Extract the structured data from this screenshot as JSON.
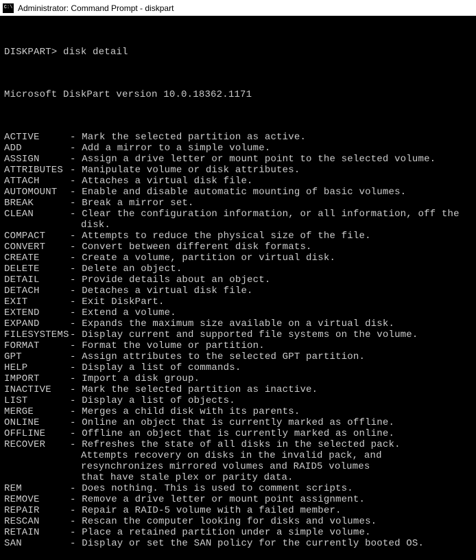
{
  "titlebar": {
    "icon_text": "C:\\",
    "title": "Administrator: Command Prompt - diskpart"
  },
  "prompt": "DISKPART>",
  "command_input": "disk detail",
  "version_line": "Microsoft DiskPart version 10.0.18362.1171",
  "commands": [
    {
      "name": "ACTIVE",
      "desc": [
        "Mark the selected partition as active."
      ]
    },
    {
      "name": "ADD",
      "desc": [
        "Add a mirror to a simple volume."
      ]
    },
    {
      "name": "ASSIGN",
      "desc": [
        "Assign a drive letter or mount point to the selected volume."
      ]
    },
    {
      "name": "ATTRIBUTES",
      "desc": [
        "Manipulate volume or disk attributes."
      ]
    },
    {
      "name": "ATTACH",
      "desc": [
        "Attaches a virtual disk file."
      ]
    },
    {
      "name": "AUTOMOUNT",
      "desc": [
        "Enable and disable automatic mounting of basic volumes."
      ]
    },
    {
      "name": "BREAK",
      "desc": [
        "Break a mirror set."
      ]
    },
    {
      "name": "CLEAN",
      "desc": [
        "Clear the configuration information, or all information, off the",
        "disk."
      ]
    },
    {
      "name": "COMPACT",
      "desc": [
        "Attempts to reduce the physical size of the file."
      ]
    },
    {
      "name": "CONVERT",
      "desc": [
        "Convert between different disk formats."
      ]
    },
    {
      "name": "CREATE",
      "desc": [
        "Create a volume, partition or virtual disk."
      ]
    },
    {
      "name": "DELETE",
      "desc": [
        "Delete an object."
      ]
    },
    {
      "name": "DETAIL",
      "desc": [
        "Provide details about an object."
      ]
    },
    {
      "name": "DETACH",
      "desc": [
        "Detaches a virtual disk file."
      ]
    },
    {
      "name": "EXIT",
      "desc": [
        "Exit DiskPart."
      ]
    },
    {
      "name": "EXTEND",
      "desc": [
        "Extend a volume."
      ]
    },
    {
      "name": "EXPAND",
      "desc": [
        "Expands the maximum size available on a virtual disk."
      ]
    },
    {
      "name": "FILESYSTEMS",
      "desc": [
        "Display current and supported file systems on the volume."
      ]
    },
    {
      "name": "FORMAT",
      "desc": [
        "Format the volume or partition."
      ]
    },
    {
      "name": "GPT",
      "desc": [
        "Assign attributes to the selected GPT partition."
      ]
    },
    {
      "name": "HELP",
      "desc": [
        "Display a list of commands."
      ]
    },
    {
      "name": "IMPORT",
      "desc": [
        "Import a disk group."
      ]
    },
    {
      "name": "INACTIVE",
      "desc": [
        "Mark the selected partition as inactive."
      ]
    },
    {
      "name": "LIST",
      "desc": [
        "Display a list of objects."
      ]
    },
    {
      "name": "MERGE",
      "desc": [
        "Merges a child disk with its parents."
      ]
    },
    {
      "name": "ONLINE",
      "desc": [
        "Online an object that is currently marked as offline."
      ]
    },
    {
      "name": "OFFLINE",
      "desc": [
        "Offline an object that is currently marked as online."
      ]
    },
    {
      "name": "RECOVER",
      "desc": [
        "Refreshes the state of all disks in the selected pack.",
        "Attempts recovery on disks in the invalid pack, and",
        "resynchronizes mirrored volumes and RAID5 volumes",
        "that have stale plex or parity data."
      ]
    },
    {
      "name": "REM",
      "desc": [
        "Does nothing. This is used to comment scripts."
      ]
    },
    {
      "name": "REMOVE",
      "desc": [
        "Remove a drive letter or mount point assignment."
      ]
    },
    {
      "name": "REPAIR",
      "desc": [
        "Repair a RAID-5 volume with a failed member."
      ]
    },
    {
      "name": "RESCAN",
      "desc": [
        "Rescan the computer looking for disks and volumes."
      ]
    },
    {
      "name": "RETAIN",
      "desc": [
        "Place a retained partition under a simple volume."
      ]
    },
    {
      "name": "SAN",
      "desc": [
        "Display or set the SAN policy for the currently booted OS."
      ]
    }
  ]
}
